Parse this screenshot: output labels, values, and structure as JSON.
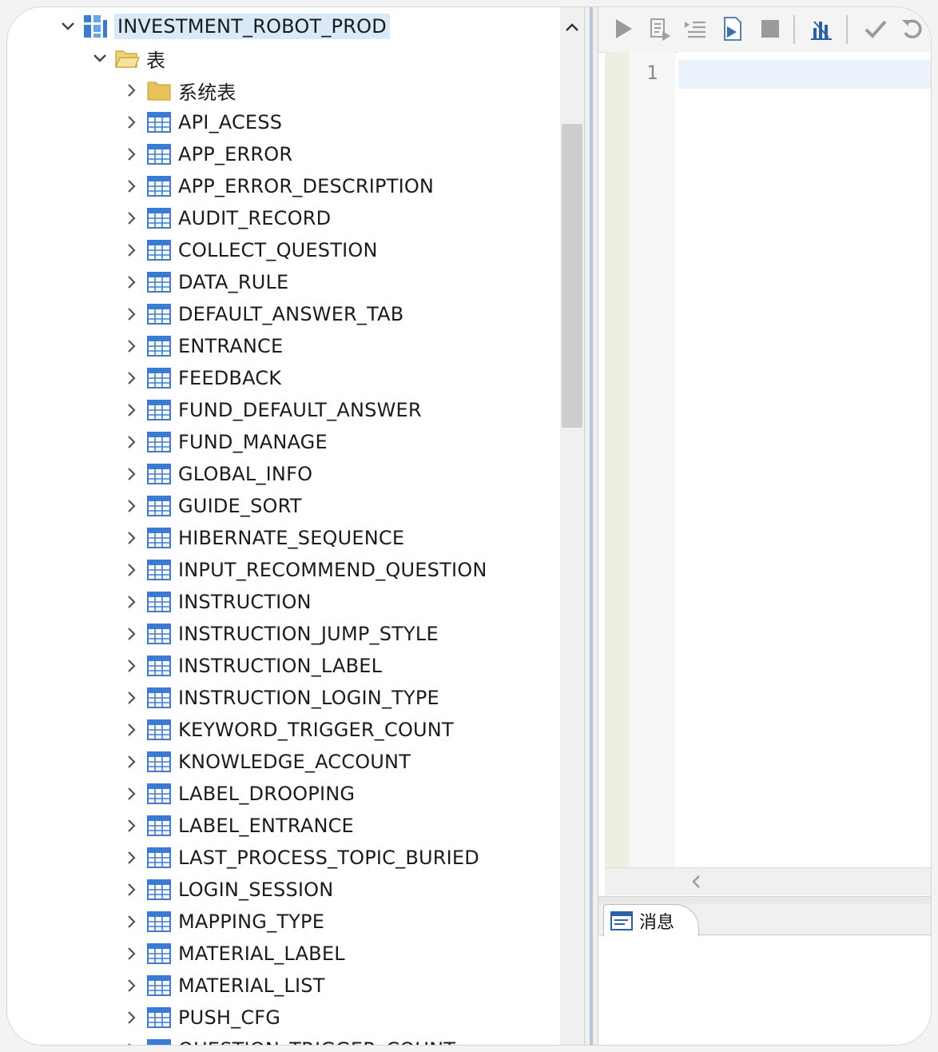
{
  "tree": {
    "root": {
      "label": "INVESTMENT_ROBOT_PROD",
      "expanded": true,
      "icon": "schema-icon"
    },
    "tables_folder": {
      "label": "表",
      "expanded": true,
      "icon": "open-folder-icon"
    },
    "system_folder": {
      "label": "系统表",
      "icon": "folder-icon"
    },
    "tables": [
      "API_ACESS",
      "APP_ERROR",
      "APP_ERROR_DESCRIPTION",
      "AUDIT_RECORD",
      "COLLECT_QUESTION",
      "DATA_RULE",
      "DEFAULT_ANSWER_TAB",
      "ENTRANCE",
      "FEEDBACK",
      "FUND_DEFAULT_ANSWER",
      "FUND_MANAGE",
      "GLOBAL_INFO",
      "GUIDE_SORT",
      "HIBERNATE_SEQUENCE",
      "INPUT_RECOMMEND_QUESTION",
      "INSTRUCTION",
      "INSTRUCTION_JUMP_STYLE",
      "INSTRUCTION_LABEL",
      "INSTRUCTION_LOGIN_TYPE",
      "KEYWORD_TRIGGER_COUNT",
      "KNOWLEDGE_ACCOUNT",
      "LABEL_DROOPING",
      "LABEL_ENTRANCE",
      "LAST_PROCESS_TOPIC_BURIED",
      "LOGIN_SESSION",
      "MAPPING_TYPE",
      "MATERIAL_LABEL",
      "MATERIAL_LIST",
      "PUSH_CFG",
      "QUESTION_TRIGGER_COUNT"
    ],
    "table_icon": "table-icon"
  },
  "editor": {
    "line_numbers": [
      "1"
    ],
    "toolbar_icons": [
      "run-icon",
      "run-selected-icon",
      "run-script-icon",
      "load-script-icon",
      "stop-icon",
      "explain-plan-icon",
      "commit-icon",
      "rollback-icon"
    ]
  },
  "messages": {
    "tab_label": "消息",
    "tab_icon": "message-icon"
  },
  "colors": {
    "selection": "#d9e9f8",
    "table_icon": "#3a7bd5",
    "folder": "#e8c15a"
  }
}
